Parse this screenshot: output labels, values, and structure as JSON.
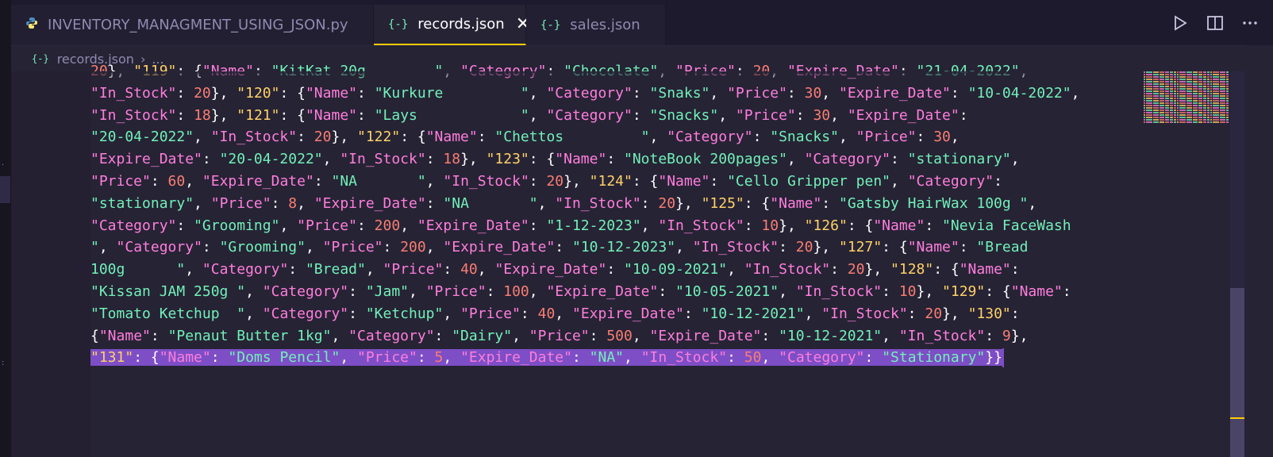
{
  "tabs": [
    {
      "label": "INVENTORY_MANAGMENT_USING_JSON.py",
      "icon": "python-icon",
      "active": false
    },
    {
      "label": "records.json",
      "icon": "json-icon",
      "active": true,
      "close": "✕"
    },
    {
      "label": "sales.json",
      "icon": "json-icon",
      "active": false
    }
  ],
  "json_icon_glyph": "{-}",
  "actions": [
    "run-icon",
    "split-editor-icon",
    "more-actions-icon"
  ],
  "breadcrumb": {
    "file": "records.json",
    "separator": "›",
    "more": "..."
  },
  "code_lines": [
    [
      [
        "n",
        "20"
      ],
      [
        "p",
        "}, "
      ],
      [
        "s",
        "\"119\""
      ],
      [
        "p",
        ": {"
      ],
      [
        "k",
        "\"Name\""
      ],
      [
        "p",
        ": "
      ],
      [
        "v",
        "\"KitKat 20g        \""
      ],
      [
        "p",
        ", "
      ],
      [
        "k",
        "\"Category\""
      ],
      [
        "p",
        ": "
      ],
      [
        "v",
        "\"Chocolate\""
      ],
      [
        "p",
        ", "
      ],
      [
        "k",
        "\"Price\""
      ],
      [
        "p",
        ": "
      ],
      [
        "n",
        "20"
      ],
      [
        "p",
        ", "
      ],
      [
        "k",
        "\"Expire_Date\""
      ],
      [
        "p",
        ": "
      ],
      [
        "v",
        "\"21-04-2022\""
      ],
      [
        "p",
        ","
      ]
    ],
    [
      [
        "k",
        "\"In_Stock\""
      ],
      [
        "p",
        ": "
      ],
      [
        "n",
        "20"
      ],
      [
        "p",
        "}, "
      ],
      [
        "s",
        "\"120\""
      ],
      [
        "p",
        ": {"
      ],
      [
        "k",
        "\"Name\""
      ],
      [
        "p",
        ": "
      ],
      [
        "v",
        "\"Kurkure         \""
      ],
      [
        "p",
        ", "
      ],
      [
        "k",
        "\"Category\""
      ],
      [
        "p",
        ": "
      ],
      [
        "v",
        "\"Snaks\""
      ],
      [
        "p",
        ", "
      ],
      [
        "k",
        "\"Price\""
      ],
      [
        "p",
        ": "
      ],
      [
        "n",
        "30"
      ],
      [
        "p",
        ", "
      ],
      [
        "k",
        "\"Expire_Date\""
      ],
      [
        "p",
        ": "
      ],
      [
        "v",
        "\"10-04-2022\""
      ],
      [
        "p",
        ","
      ]
    ],
    [
      [
        "k",
        "\"In_Stock\""
      ],
      [
        "p",
        ": "
      ],
      [
        "n",
        "18"
      ],
      [
        "p",
        "}, "
      ],
      [
        "s",
        "\"121\""
      ],
      [
        "p",
        ": {"
      ],
      [
        "k",
        "\"Name\""
      ],
      [
        "p",
        ": "
      ],
      [
        "v",
        "\"Lays            \""
      ],
      [
        "p",
        ", "
      ],
      [
        "k",
        "\"Category\""
      ],
      [
        "p",
        ": "
      ],
      [
        "v",
        "\"Snacks\""
      ],
      [
        "p",
        ", "
      ],
      [
        "k",
        "\"Price\""
      ],
      [
        "p",
        ": "
      ],
      [
        "n",
        "30"
      ],
      [
        "p",
        ", "
      ],
      [
        "k",
        "\"Expire_Date\""
      ],
      [
        "p",
        ":"
      ]
    ],
    [
      [
        "v",
        "\"20-04-2022\""
      ],
      [
        "p",
        ", "
      ],
      [
        "k",
        "\"In_Stock\""
      ],
      [
        "p",
        ": "
      ],
      [
        "n",
        "20"
      ],
      [
        "p",
        "}, "
      ],
      [
        "s",
        "\"122\""
      ],
      [
        "p",
        ": {"
      ],
      [
        "k",
        "\"Name\""
      ],
      [
        "p",
        ": "
      ],
      [
        "v",
        "\"Chettos         \""
      ],
      [
        "p",
        ", "
      ],
      [
        "k",
        "\"Category\""
      ],
      [
        "p",
        ": "
      ],
      [
        "v",
        "\"Snacks\""
      ],
      [
        "p",
        ", "
      ],
      [
        "k",
        "\"Price\""
      ],
      [
        "p",
        ": "
      ],
      [
        "n",
        "30"
      ],
      [
        "p",
        ","
      ]
    ],
    [
      [
        "k",
        "\"Expire_Date\""
      ],
      [
        "p",
        ": "
      ],
      [
        "v",
        "\"20-04-2022\""
      ],
      [
        "p",
        ", "
      ],
      [
        "k",
        "\"In_Stock\""
      ],
      [
        "p",
        ": "
      ],
      [
        "n",
        "18"
      ],
      [
        "p",
        "}, "
      ],
      [
        "s",
        "\"123\""
      ],
      [
        "p",
        ": {"
      ],
      [
        "k",
        "\"Name\""
      ],
      [
        "p",
        ": "
      ],
      [
        "v",
        "\"NoteBook 200pages\""
      ],
      [
        "p",
        ", "
      ],
      [
        "k",
        "\"Category\""
      ],
      [
        "p",
        ": "
      ],
      [
        "v",
        "\"stationary\""
      ],
      [
        "p",
        ","
      ]
    ],
    [
      [
        "k",
        "\"Price\""
      ],
      [
        "p",
        ": "
      ],
      [
        "n",
        "60"
      ],
      [
        "p",
        ", "
      ],
      [
        "k",
        "\"Expire_Date\""
      ],
      [
        "p",
        ": "
      ],
      [
        "v",
        "\"NA       \""
      ],
      [
        "p",
        ", "
      ],
      [
        "k",
        "\"In_Stock\""
      ],
      [
        "p",
        ": "
      ],
      [
        "n",
        "20"
      ],
      [
        "p",
        "}, "
      ],
      [
        "s",
        "\"124\""
      ],
      [
        "p",
        ": {"
      ],
      [
        "k",
        "\"Name\""
      ],
      [
        "p",
        ": "
      ],
      [
        "v",
        "\"Cello Gripper pen\""
      ],
      [
        "p",
        ", "
      ],
      [
        "k",
        "\"Category\""
      ],
      [
        "p",
        ":"
      ]
    ],
    [
      [
        "v",
        "\"stationary\""
      ],
      [
        "p",
        ", "
      ],
      [
        "k",
        "\"Price\""
      ],
      [
        "p",
        ": "
      ],
      [
        "n",
        "8"
      ],
      [
        "p",
        ", "
      ],
      [
        "k",
        "\"Expire_Date\""
      ],
      [
        "p",
        ": "
      ],
      [
        "v",
        "\"NA       \""
      ],
      [
        "p",
        ", "
      ],
      [
        "k",
        "\"In_Stock\""
      ],
      [
        "p",
        ": "
      ],
      [
        "n",
        "20"
      ],
      [
        "p",
        "}, "
      ],
      [
        "s",
        "\"125\""
      ],
      [
        "p",
        ": {"
      ],
      [
        "k",
        "\"Name\""
      ],
      [
        "p",
        ": "
      ],
      [
        "v",
        "\"Gatsby HairWax 100g \""
      ],
      [
        "p",
        ","
      ]
    ],
    [
      [
        "k",
        "\"Category\""
      ],
      [
        "p",
        ": "
      ],
      [
        "v",
        "\"Grooming\""
      ],
      [
        "p",
        ", "
      ],
      [
        "k",
        "\"Price\""
      ],
      [
        "p",
        ": "
      ],
      [
        "n",
        "200"
      ],
      [
        "p",
        ", "
      ],
      [
        "k",
        "\"Expire_Date\""
      ],
      [
        "p",
        ": "
      ],
      [
        "v",
        "\"1-12-2023\""
      ],
      [
        "p",
        ", "
      ],
      [
        "k",
        "\"In_Stock\""
      ],
      [
        "p",
        ": "
      ],
      [
        "n",
        "10"
      ],
      [
        "p",
        "}, "
      ],
      [
        "s",
        "\"126\""
      ],
      [
        "p",
        ": {"
      ],
      [
        "k",
        "\"Name\""
      ],
      [
        "p",
        ": "
      ],
      [
        "v",
        "\"Nevia FaceWash"
      ]
    ],
    [
      [
        "v",
        "\""
      ],
      [
        "p",
        ", "
      ],
      [
        "k",
        "\"Category\""
      ],
      [
        "p",
        ": "
      ],
      [
        "v",
        "\"Grooming\""
      ],
      [
        "p",
        ", "
      ],
      [
        "k",
        "\"Price\""
      ],
      [
        "p",
        ": "
      ],
      [
        "n",
        "200"
      ],
      [
        "p",
        ", "
      ],
      [
        "k",
        "\"Expire_Date\""
      ],
      [
        "p",
        ": "
      ],
      [
        "v",
        "\"10-12-2023\""
      ],
      [
        "p",
        ", "
      ],
      [
        "k",
        "\"In_Stock\""
      ],
      [
        "p",
        ": "
      ],
      [
        "n",
        "20"
      ],
      [
        "p",
        "}, "
      ],
      [
        "s",
        "\"127\""
      ],
      [
        "p",
        ": {"
      ],
      [
        "k",
        "\"Name\""
      ],
      [
        "p",
        ": "
      ],
      [
        "v",
        "\"Bread"
      ]
    ],
    [
      [
        "v",
        "100g      \""
      ],
      [
        "p",
        ", "
      ],
      [
        "k",
        "\"Category\""
      ],
      [
        "p",
        ": "
      ],
      [
        "v",
        "\"Bread\""
      ],
      [
        "p",
        ", "
      ],
      [
        "k",
        "\"Price\""
      ],
      [
        "p",
        ": "
      ],
      [
        "n",
        "40"
      ],
      [
        "p",
        ", "
      ],
      [
        "k",
        "\"Expire_Date\""
      ],
      [
        "p",
        ": "
      ],
      [
        "v",
        "\"10-09-2021\""
      ],
      [
        "p",
        ", "
      ],
      [
        "k",
        "\"In_Stock\""
      ],
      [
        "p",
        ": "
      ],
      [
        "n",
        "20"
      ],
      [
        "p",
        "}, "
      ],
      [
        "s",
        "\"128\""
      ],
      [
        "p",
        ": {"
      ],
      [
        "k",
        "\"Name\""
      ],
      [
        "p",
        ":"
      ]
    ],
    [
      [
        "v",
        "\"Kissan JAM 250g \""
      ],
      [
        "p",
        ", "
      ],
      [
        "k",
        "\"Category\""
      ],
      [
        "p",
        ": "
      ],
      [
        "v",
        "\"Jam\""
      ],
      [
        "p",
        ", "
      ],
      [
        "k",
        "\"Price\""
      ],
      [
        "p",
        ": "
      ],
      [
        "n",
        "100"
      ],
      [
        "p",
        ", "
      ],
      [
        "k",
        "\"Expire_Date\""
      ],
      [
        "p",
        ": "
      ],
      [
        "v",
        "\"10-05-2021\""
      ],
      [
        "p",
        ", "
      ],
      [
        "k",
        "\"In_Stock\""
      ],
      [
        "p",
        ": "
      ],
      [
        "n",
        "10"
      ],
      [
        "p",
        "}, "
      ],
      [
        "s",
        "\"129\""
      ],
      [
        "p",
        ": {"
      ],
      [
        "k",
        "\"Name\""
      ],
      [
        "p",
        ":"
      ]
    ],
    [
      [
        "v",
        "\"Tomato Ketchup  \""
      ],
      [
        "p",
        ", "
      ],
      [
        "k",
        "\"Category\""
      ],
      [
        "p",
        ": "
      ],
      [
        "v",
        "\"Ketchup\""
      ],
      [
        "p",
        ", "
      ],
      [
        "k",
        "\"Price\""
      ],
      [
        "p",
        ": "
      ],
      [
        "n",
        "40"
      ],
      [
        "p",
        ", "
      ],
      [
        "k",
        "\"Expire_Date\""
      ],
      [
        "p",
        ": "
      ],
      [
        "v",
        "\"10-12-2021\""
      ],
      [
        "p",
        ", "
      ],
      [
        "k",
        "\"In_Stock\""
      ],
      [
        "p",
        ": "
      ],
      [
        "n",
        "20"
      ],
      [
        "p",
        "}, "
      ],
      [
        "s",
        "\"130\""
      ],
      [
        "p",
        ":"
      ]
    ],
    [
      [
        "p",
        "{"
      ],
      [
        "k",
        "\"Name\""
      ],
      [
        "p",
        ": "
      ],
      [
        "v",
        "\"Penaut Butter 1kg\""
      ],
      [
        "p",
        ", "
      ],
      [
        "k",
        "\"Category\""
      ],
      [
        "p",
        ": "
      ],
      [
        "v",
        "\"Dairy\""
      ],
      [
        "p",
        ", "
      ],
      [
        "k",
        "\"Price\""
      ],
      [
        "p",
        ": "
      ],
      [
        "n",
        "500"
      ],
      [
        "p",
        ", "
      ],
      [
        "k",
        "\"Expire_Date\""
      ],
      [
        "p",
        ": "
      ],
      [
        "v",
        "\"10-12-2021\""
      ],
      [
        "p",
        ", "
      ],
      [
        "k",
        "\"In_Stock\""
      ],
      [
        "p",
        ": "
      ],
      [
        "n",
        "9"
      ],
      [
        "p",
        "},"
      ]
    ],
    [
      [
        "s",
        "\"131\""
      ],
      [
        "p",
        ": {"
      ],
      [
        "k",
        "\"Name\""
      ],
      [
        "p",
        ": "
      ],
      [
        "v",
        "\"Doms Pencil\""
      ],
      [
        "p",
        ", "
      ],
      [
        "k",
        "\"Price\""
      ],
      [
        "p",
        ": "
      ],
      [
        "n",
        "5"
      ],
      [
        "p",
        ", "
      ],
      [
        "k",
        "\"Expire_Date\""
      ],
      [
        "p",
        ": "
      ],
      [
        "v",
        "\"NA\""
      ],
      [
        "p",
        ", "
      ],
      [
        "k",
        "\"In_Stock\""
      ],
      [
        "p",
        ": "
      ],
      [
        "n",
        "50"
      ],
      [
        "p",
        ", "
      ],
      [
        "k",
        "\"Category\""
      ],
      [
        "p",
        ": "
      ],
      [
        "v",
        "\"Stationary\""
      ],
      [
        "p",
        "}}"
      ]
    ]
  ],
  "selected_line": 13,
  "colors": {
    "background": "#262335",
    "keys": "#ff7edb",
    "ids": "#ffd166",
    "strings": "#72f1b8",
    "numbers": "#f97e72",
    "selection": "#7d4ec6",
    "cursor": "#ffcc00"
  }
}
